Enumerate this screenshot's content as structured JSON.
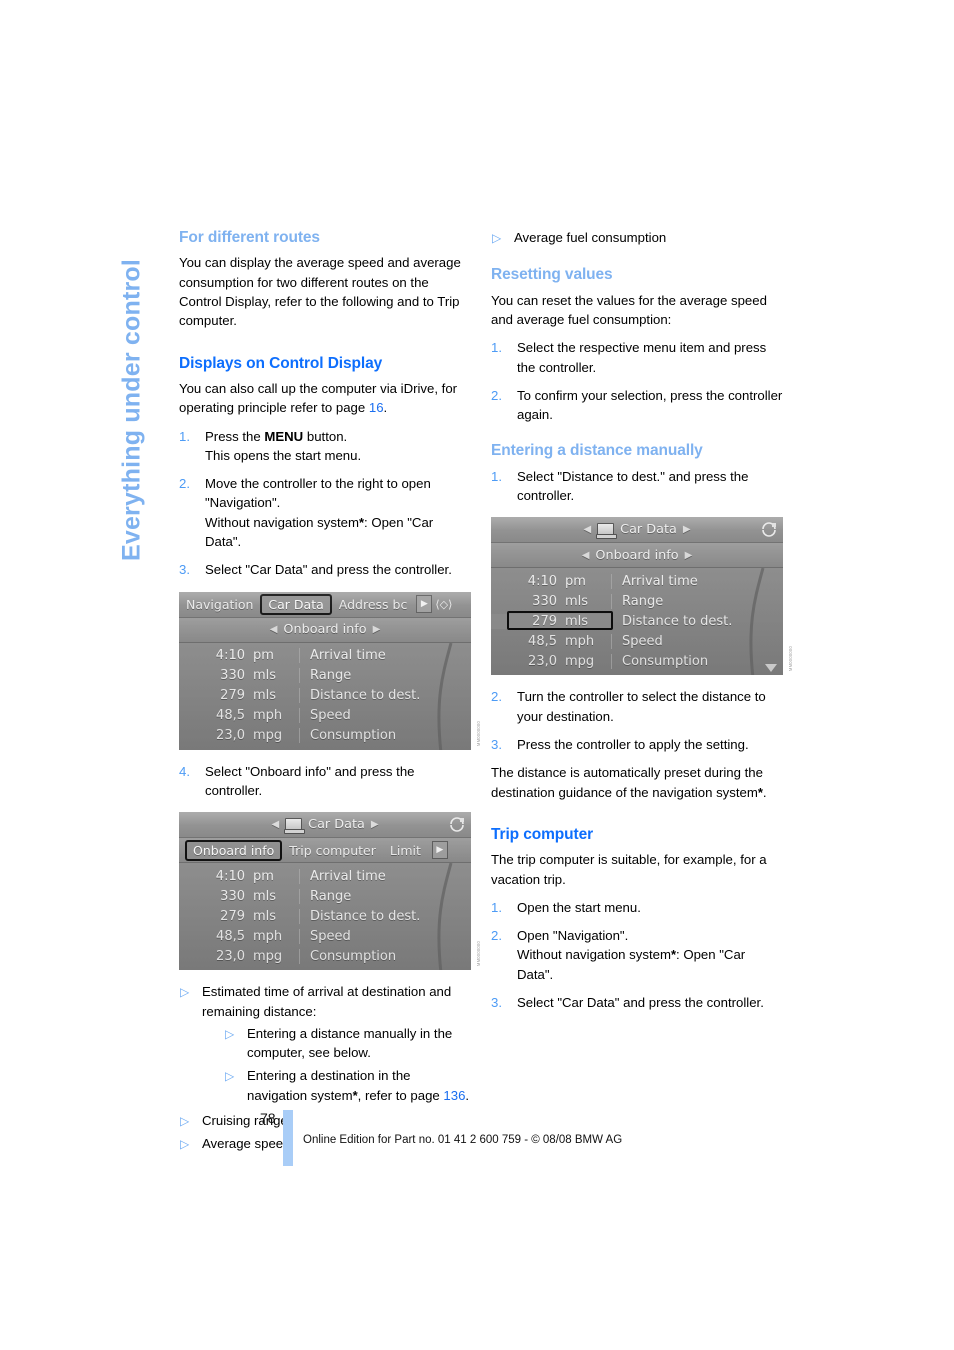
{
  "chapter_tab": {
    "label": "Everything under control"
  },
  "left_column": {
    "heading_routes": "For different routes",
    "para_routes": "You can display the average speed and average consumption for two different routes on the Control Display, refer to the following and to Trip computer.",
    "heading_displays": "Displays on Control Display",
    "para_displays_1": "You can also call up the computer via iDrive, for operating principle refer to page ",
    "para_displays_link": "16",
    "para_displays_2": ".",
    "steps": [
      {
        "num": "1.",
        "line1_a": "Press the ",
        "line1_bold": "MENU",
        "line1_b": " button.",
        "line2": "This opens the start menu."
      },
      {
        "num": "2.",
        "line1": "Move the controller to the right to open \"Navigation\".",
        "line2_a": "Without navigation system",
        "line2_star": "*",
        "line2_b": ": Open \"Car Data\"."
      },
      {
        "num": "3.",
        "line1": "Select \"Car Data\" and press the controller."
      },
      {
        "num": "4.",
        "line1": "Select \"Onboard info\" and press the controller."
      }
    ],
    "bullets": [
      "Estimated time of arrival at destination and remaining distance:",
      "Cruising range",
      "Average speed"
    ],
    "nested_bullets": [
      {
        "text": "Entering a distance manually in the computer, see below."
      },
      {
        "text_a": "Entering a destination in the navigation system",
        "star": "*",
        "text_b": ", refer to page ",
        "link": "136",
        "text_c": "."
      }
    ]
  },
  "right_column": {
    "bullet_avg_fuel": "Average fuel consumption",
    "heading_resetting": "Resetting values",
    "para_resetting": "You can reset the values for the average speed and average fuel consumption:",
    "steps_resetting": [
      {
        "num": "1.",
        "text": "Select the respective menu item and press the controller."
      },
      {
        "num": "2.",
        "text": "To confirm your selection, press the controller again."
      }
    ],
    "heading_entering": "Entering a distance manually",
    "steps_entering": [
      {
        "num": "1.",
        "text": "Select \"Distance to dest.\" and press the controller."
      },
      {
        "num": "2.",
        "text": "Turn the controller to select the distance to your destination."
      },
      {
        "num": "3.",
        "text": "Press the controller to apply the setting."
      }
    ],
    "para_preset_a": "The distance is automatically preset during the destination guidance of the navigation system",
    "para_preset_star": "*",
    "para_preset_b": ".",
    "heading_trip": "Trip computer",
    "para_trip": "The trip computer is suitable, for example, for a vacation trip.",
    "steps_trip": [
      {
        "num": "1.",
        "line1": "Open the start menu."
      },
      {
        "num": "2.",
        "line1": "Open \"Navigation\".",
        "line2_a": "Without navigation system",
        "line2_star": "*",
        "line2_b": ": Open \"Car Data\"."
      },
      {
        "num": "3.",
        "line1": "Select \"Car Data\" and press the controller."
      }
    ]
  },
  "screenshots": {
    "shot1": {
      "tabs": [
        {
          "label": "Navigation",
          "selected": false
        },
        {
          "label": "Car Data",
          "selected": true
        },
        {
          "label": "Address bc",
          "selected": false
        }
      ],
      "subtitle": "Onboard info",
      "rows": [
        {
          "value": "4:10",
          "unit": "pm",
          "label": "Arrival time",
          "selected": false
        },
        {
          "value": "330",
          "unit": "mls",
          "label": "Range",
          "selected": false
        },
        {
          "value": "279",
          "unit": "mls",
          "label": "Distance to dest.",
          "selected": false
        },
        {
          "value": "48,5",
          "unit": "mph",
          "label": "Speed",
          "selected": false
        },
        {
          "value": "23,0",
          "unit": "mpg",
          "label": "Consumption",
          "selected": false
        }
      ],
      "caption": "MM0000000"
    },
    "shot2": {
      "title": "Car Data",
      "tabs": [
        {
          "label": "Onboard info",
          "selected": true
        },
        {
          "label": "Trip computer",
          "selected": false
        },
        {
          "label": "Limit",
          "selected": false
        }
      ],
      "rows": [
        {
          "value": "4:10",
          "unit": "pm",
          "label": "Arrival time",
          "selected": false
        },
        {
          "value": "330",
          "unit": "mls",
          "label": "Range",
          "selected": false
        },
        {
          "value": "279",
          "unit": "mls",
          "label": "Distance to dest.",
          "selected": false
        },
        {
          "value": "48,5",
          "unit": "mph",
          "label": "Speed",
          "selected": false
        },
        {
          "value": "23,0",
          "unit": "mpg",
          "label": "Consumption",
          "selected": false
        }
      ],
      "caption": "MM0000000"
    },
    "shot3": {
      "title": "Car Data",
      "subtitle": "Onboard info",
      "rows": [
        {
          "value": "4:10",
          "unit": "pm",
          "label": "Arrival time",
          "selected": false
        },
        {
          "value": "330",
          "unit": "mls",
          "label": "Range",
          "selected": false
        },
        {
          "value": "279",
          "unit": "mls",
          "label": "Distance to dest.",
          "selected": true
        },
        {
          "value": "48,5",
          "unit": "mph",
          "label": "Speed",
          "selected": false
        },
        {
          "value": "23,0",
          "unit": "mpg",
          "label": "Consumption",
          "selected": false
        }
      ],
      "caption": "MM0000000"
    }
  },
  "footer": {
    "page_number": "78",
    "text": "Online Edition for Part no. 01 41 2 600 759 - © 08/08 BMW AG"
  },
  "colors": {
    "heading_main": "#0d6efd",
    "heading_sub": "#7fb2f0",
    "link": "#1a6ef0",
    "footer_bar": "#a9cdf7"
  }
}
